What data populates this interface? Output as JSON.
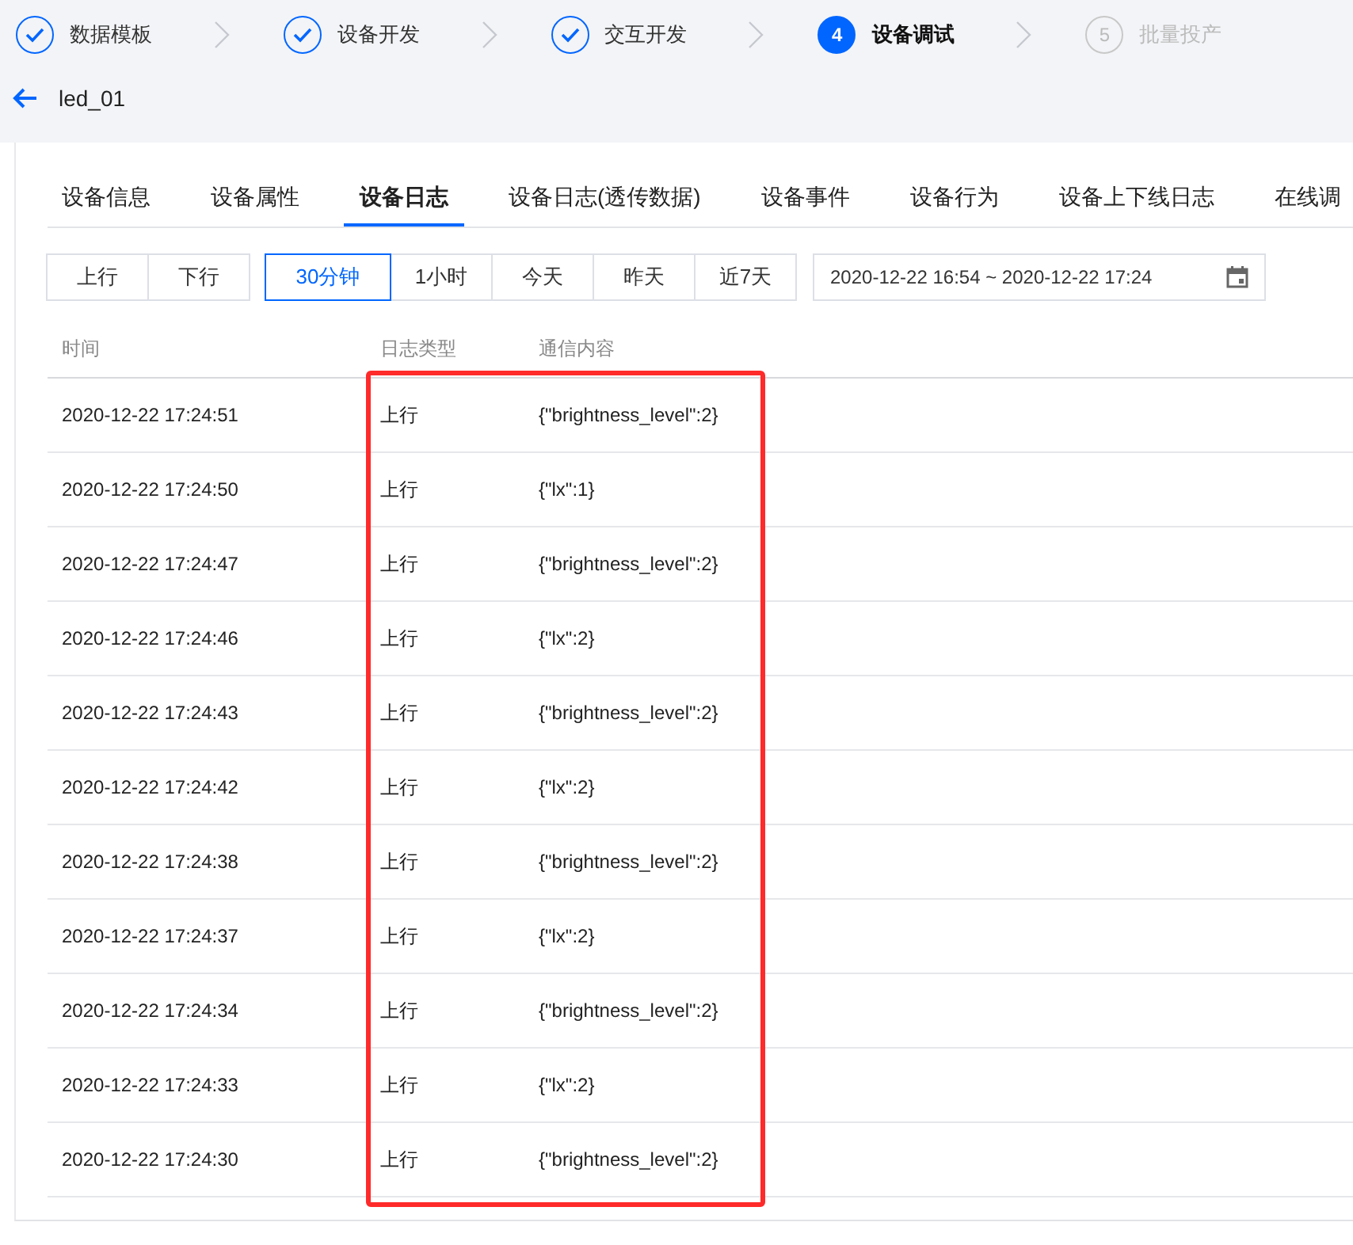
{
  "steps": [
    {
      "label": "数据模板",
      "done": true,
      "selected": false
    },
    {
      "label": "设备开发",
      "done": true,
      "selected": false
    },
    {
      "label": "交互开发",
      "done": true,
      "selected": false
    },
    {
      "number": "4",
      "label": "设备调试",
      "done": false,
      "selected": true
    },
    {
      "number": "5",
      "label": "批量投产",
      "done": false,
      "selected": false
    }
  ],
  "device": {
    "name": "led_01"
  },
  "tabs": [
    {
      "label": "设备信息",
      "selected": false
    },
    {
      "label": "设备属性",
      "selected": false
    },
    {
      "label": "设备日志",
      "selected": true
    },
    {
      "label": "设备日志(透传数据)",
      "selected": false
    },
    {
      "label": "设备事件",
      "selected": false
    },
    {
      "label": "设备行为",
      "selected": false
    },
    {
      "label": "设备上下线日志",
      "selected": false
    },
    {
      "label": "在线调",
      "selected": false
    }
  ],
  "direction_filter": [
    {
      "label": "上行",
      "selected": false
    },
    {
      "label": "下行",
      "selected": false
    }
  ],
  "time_filter": [
    {
      "label": "30分钟",
      "selected": true
    },
    {
      "label": "1小时",
      "selected": false
    },
    {
      "label": "今天",
      "selected": false
    },
    {
      "label": "昨天",
      "selected": false
    },
    {
      "label": "近7天",
      "selected": false
    }
  ],
  "date_range": {
    "value": "2020-12-22 16:54 ~ 2020-12-22 17:24"
  },
  "table": {
    "columns": [
      "时间",
      "日志类型",
      "通信内容"
    ],
    "rows": [
      [
        "2020-12-22 17:24:51",
        "上行",
        "{\"brightness_level\":2}"
      ],
      [
        "2020-12-22 17:24:50",
        "上行",
        "{\"lx\":1}"
      ],
      [
        "2020-12-22 17:24:47",
        "上行",
        "{\"brightness_level\":2}"
      ],
      [
        "2020-12-22 17:24:46",
        "上行",
        "{\"lx\":2}"
      ],
      [
        "2020-12-22 17:24:43",
        "上行",
        "{\"brightness_level\":2}"
      ],
      [
        "2020-12-22 17:24:42",
        "上行",
        "{\"lx\":2}"
      ],
      [
        "2020-12-22 17:24:38",
        "上行",
        "{\"brightness_level\":2}"
      ],
      [
        "2020-12-22 17:24:37",
        "上行",
        "{\"lx\":2}"
      ],
      [
        "2020-12-22 17:24:34",
        "上行",
        "{\"brightness_level\":2}"
      ],
      [
        "2020-12-22 17:24:33",
        "上行",
        "{\"lx\":2}"
      ],
      [
        "2020-12-22 17:24:30",
        "上行",
        "{\"brightness_level\":2}"
      ]
    ]
  },
  "annotation": {
    "kind": "highlight-box",
    "color": "#ff2a2a"
  }
}
